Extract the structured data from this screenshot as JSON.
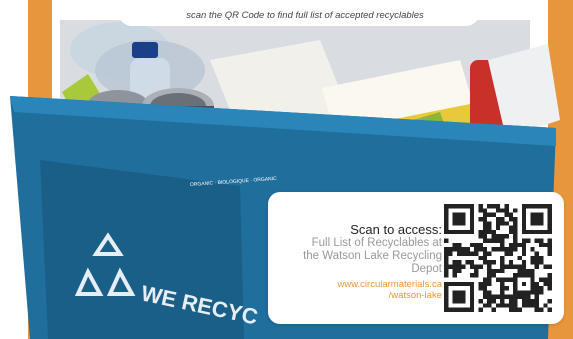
{
  "caption": "scan the QR Code to find full list of accepted recyclables",
  "scan_card": {
    "title": "Scan to access:",
    "description_lines": [
      "Full List of Recyclables at",
      "the Watson Lake Recycling",
      "Depot"
    ],
    "url_lines": [
      "www.circularmaterials.ca",
      "/watson-lake"
    ]
  },
  "photo": {
    "bin_text": "WE RECYC",
    "carton_label": "ORGANIC · BIOLOGIQUE · ORGANIC"
  },
  "colors": {
    "accent_orange": "#e8963d",
    "bin_blue": "#1f6e9c",
    "text_dark": "#222222",
    "text_grey": "#9a9a9a"
  },
  "icons": [
    "recycle-icon",
    "qr-code-icon"
  ]
}
